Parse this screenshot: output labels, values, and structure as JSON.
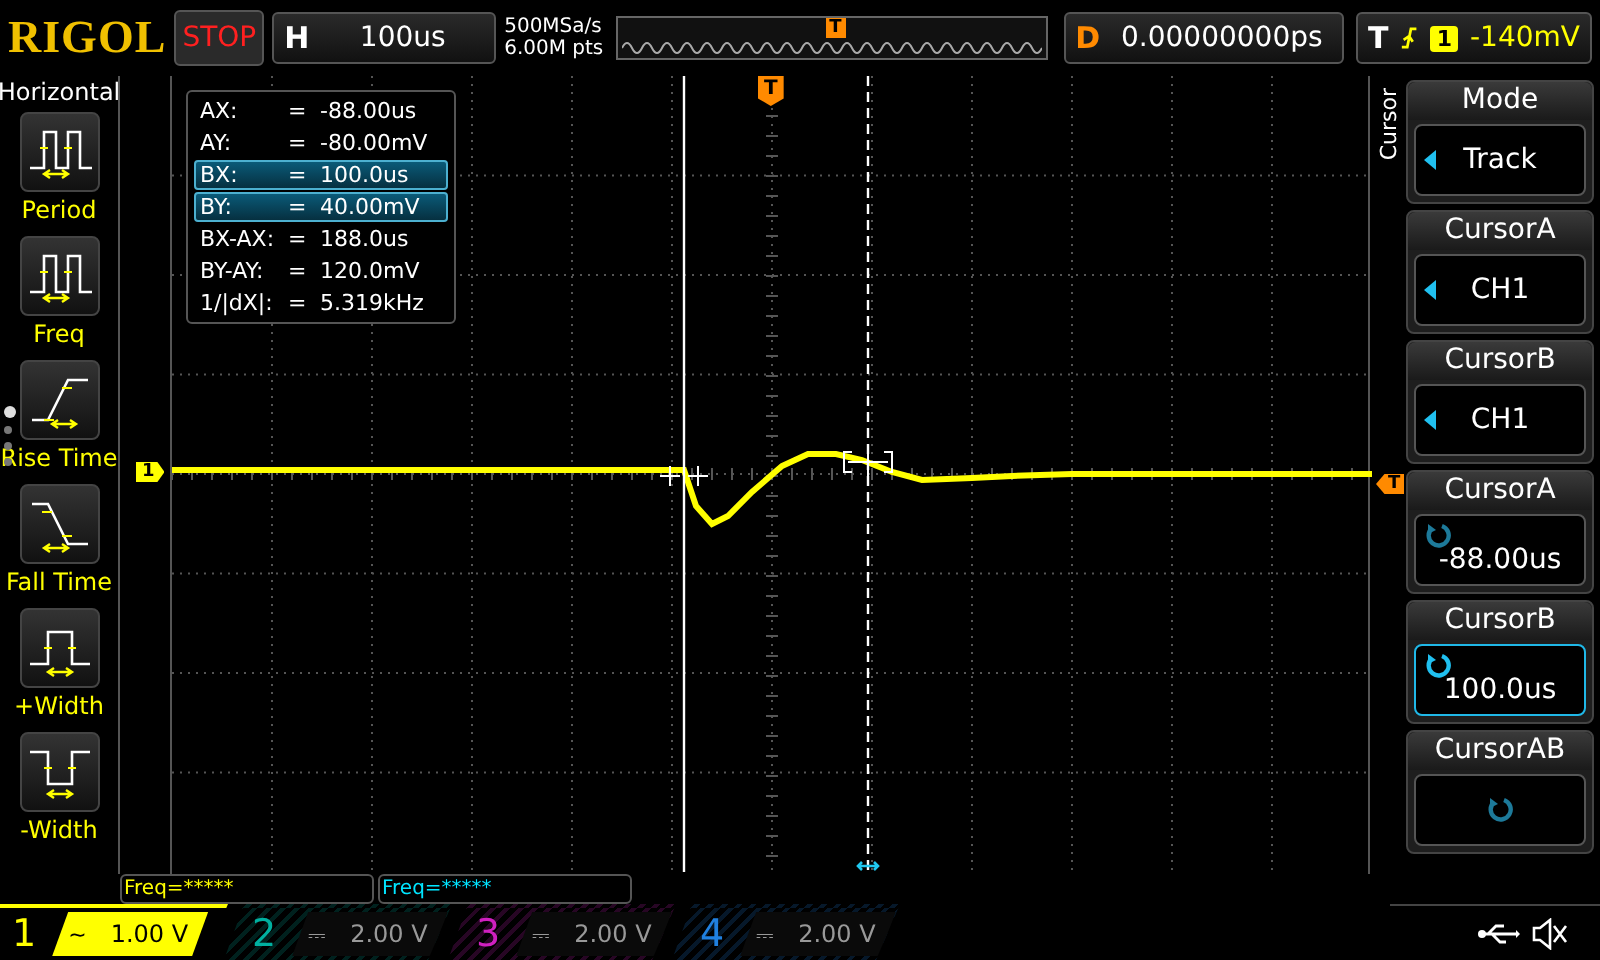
{
  "top_bar": {
    "brand": "RIGOL",
    "run_state": "STOP",
    "horizontal": {
      "label": "H",
      "value": "100us"
    },
    "sample_rate": "500MSa/s",
    "memory_depth": "6.00M pts",
    "overview_marker": "T",
    "delay": {
      "label": "D",
      "value": "0.00000000ps"
    },
    "trigger": {
      "label": "T",
      "source": "1",
      "level": "-140mV"
    }
  },
  "measure_panel": {
    "title": "Horizontal",
    "items": [
      {
        "label": "Period",
        "kind": "period"
      },
      {
        "label": "Freq",
        "kind": "freq"
      },
      {
        "label": "Rise Time",
        "kind": "rise"
      },
      {
        "label": "Fall Time",
        "kind": "fall"
      },
      {
        "label": "+Width",
        "kind": "pwidth"
      },
      {
        "label": "-Width",
        "kind": "nwidth"
      }
    ],
    "pages": [
      {
        "selected": true
      },
      {
        "selected": false
      },
      {
        "selected": false
      },
      {
        "selected": false
      }
    ]
  },
  "screen": {
    "channel_marker": "1",
    "trigger_marker": "T",
    "trigger_level_marker": "T",
    "cursor_readout": [
      {
        "label": "AX:",
        "sign": "=",
        "value": "-88.00us",
        "selected": false
      },
      {
        "label": "AY:",
        "sign": "=",
        "value": "-80.00mV",
        "selected": false
      },
      {
        "label": "BX:",
        "sign": "=",
        "value": "100.0us",
        "selected": true
      },
      {
        "label": "BY:",
        "sign": "=",
        "value": "40.00mV",
        "selected": true
      },
      {
        "label": "BX-AX:",
        "sign": "=",
        "value": "188.0us",
        "selected": false
      },
      {
        "label": "BY-AY:",
        "sign": "=",
        "value": "120.0mV",
        "selected": false
      },
      {
        "label": "1/|dX|:",
        "sign": "=",
        "value": "5.319kHz",
        "selected": false
      }
    ]
  },
  "menu": {
    "title": "Cursor",
    "items": [
      {
        "title": "Mode",
        "value": "Track",
        "kind": "select",
        "selected": false
      },
      {
        "title": "CursorA",
        "value": "CH1",
        "kind": "select",
        "selected": false
      },
      {
        "title": "CursorB",
        "value": "CH1",
        "kind": "select",
        "selected": false
      },
      {
        "title": "CursorA",
        "value": "-88.00us",
        "kind": "knob",
        "selected": false
      },
      {
        "title": "CursorB",
        "value": "100.0us",
        "kind": "knob",
        "selected": true
      },
      {
        "title": "CursorAB",
        "kind": "knob",
        "selected": false
      }
    ]
  },
  "freq_readouts": [
    {
      "text": "Freq=*****",
      "color": "#ffff00"
    },
    {
      "text": "Freq=*****",
      "color": "#00e5ff"
    }
  ],
  "channels": [
    {
      "number": "1",
      "coupling": "~",
      "scale": "1.00 V",
      "on": true,
      "color": "#ffff00"
    },
    {
      "number": "2",
      "coupling": "⎓",
      "scale": "2.00 V",
      "on": false,
      "color": "#00b0a0"
    },
    {
      "number": "3",
      "coupling": "⎓",
      "scale": "2.00 V",
      "on": false,
      "color": "#d020c0"
    },
    {
      "number": "4",
      "coupling": "⎓",
      "scale": "2.00 V",
      "on": false,
      "color": "#2080e0"
    }
  ]
}
